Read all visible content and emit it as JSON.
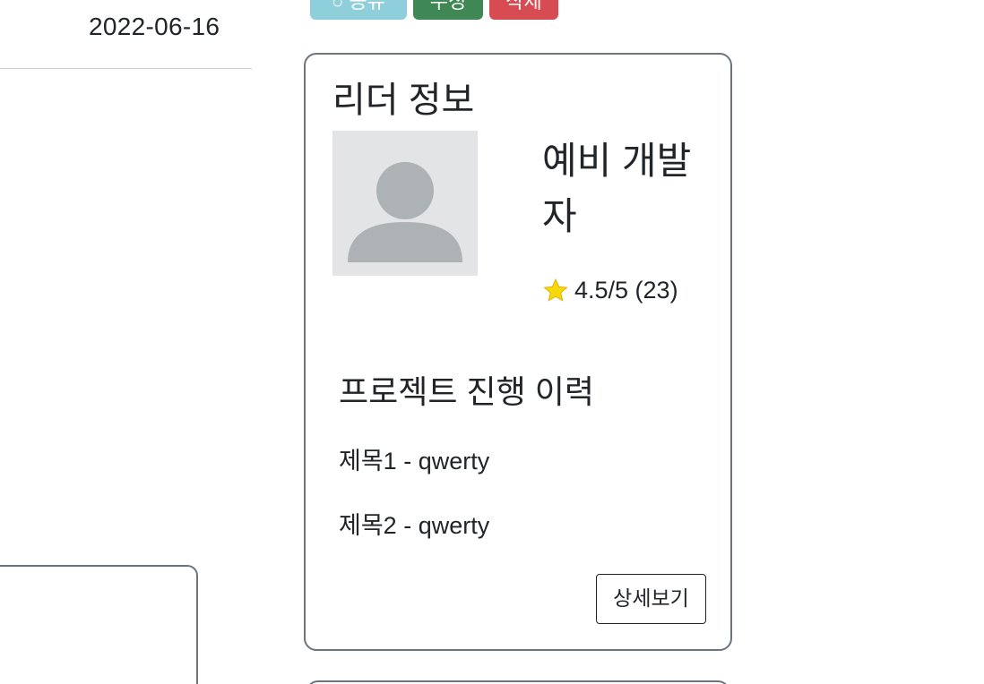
{
  "toolbar": {
    "info_label": "○ 공유",
    "edit_label": "수정",
    "delete_label": "삭제"
  },
  "left_panel": {
    "date": "2022-06-16"
  },
  "leader_card": {
    "title": "리더 정보",
    "avatar_icon": "user-silhouette-icon",
    "name": "예비 개발자",
    "rating_icon": "star-icon",
    "rating_text": "4.5/5 (23)",
    "history_title": "프로젝트 진행 이력",
    "history_items": [
      "제목1 - qwerty",
      "제목2 - qwerty"
    ],
    "detail_button": "상세보기"
  },
  "colors": {
    "info": "#8fcfdc",
    "success": "#3f8856",
    "danger": "#d74b52",
    "border": "#6c757d",
    "star": "#f5d90a"
  }
}
